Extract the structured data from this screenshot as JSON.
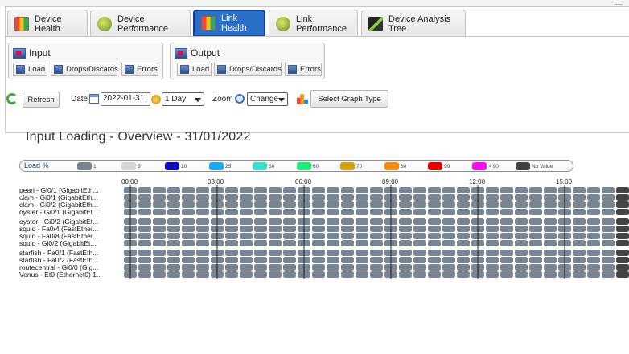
{
  "tabs": [
    {
      "label": "Device Health",
      "icon": "health-chart-icon",
      "active": false
    },
    {
      "label": "Device Performance",
      "icon": "performance-globe-icon",
      "active": false
    },
    {
      "label": "Link Health",
      "icon": "health-chart-icon",
      "active": true
    },
    {
      "label": "Link Performance",
      "icon": "performance-globe-icon",
      "active": false
    },
    {
      "label": "Device Analysis Tree",
      "icon": "analysis-tree-icon",
      "active": false
    }
  ],
  "input_group": {
    "title": "Input",
    "buttons": [
      "Load",
      "Drops/Discards",
      "Errors"
    ]
  },
  "output_group": {
    "title": "Output",
    "buttons": [
      "Load",
      "Drops/Discards",
      "Errors"
    ]
  },
  "controls": {
    "refresh_label": "Refresh",
    "date_label": "Date",
    "date_value": "2022-01-31",
    "period_value": "1 Day",
    "zoom_label": "Zoom",
    "zoom_value": "Change",
    "graph_type_label": "Select Graph Type"
  },
  "chart_title": "Input Loading - Overview - 31/01/2022",
  "legend": {
    "title": "Load %",
    "items": [
      {
        "label": "1",
        "color": "#7a8594"
      },
      {
        "label": "5",
        "color": "#d4d4d4"
      },
      {
        "label": "10",
        "color": "#0a0ab8"
      },
      {
        "label": "25",
        "color": "#1aa8f0"
      },
      {
        "label": "50",
        "color": "#3ddcc8"
      },
      {
        "label": "60",
        "color": "#1fe878"
      },
      {
        "label": "70",
        "color": "#d4a017"
      },
      {
        "label": "80",
        "color": "#f08a12"
      },
      {
        "label": "90",
        "color": "#e00000"
      },
      {
        "label": "> 90",
        "color": "#ee10ee"
      },
      {
        "label": "No Value",
        "color": "#444444"
      }
    ]
  },
  "chart_data": {
    "type": "heatmap",
    "title": "Input Loading - Overview - 31/01/2022",
    "x_tick_labels": [
      "00:00",
      "03:00",
      "06:00",
      "09:00",
      "12:00",
      "15:00"
    ],
    "rows": [
      "pearl - Gi0/1 (GigabitEth...",
      "clam - Gi0/1 (GigabitEth...",
      "clam - Gi0/2 (GigabitEth...",
      "oyster - Gi0/1 (GigabitEt...",
      "oyster - Gi0/2 (GigabitEt...",
      "squid - Fa0/4 (FastEther...",
      "squid - Fa0/8 (FastEther...",
      "squid - Gi0/2 (GigabitEt...",
      "starfish - Fa0/1 (FastEth...",
      "starfish - Fa0/2 (FastEth...",
      "routecentral - Gi0/0 (Gig...",
      "Venus - Et0 (Ethernet0) 1..."
    ],
    "columns_visible": 35,
    "cell_value": "1",
    "last_column_value": "No Value"
  }
}
